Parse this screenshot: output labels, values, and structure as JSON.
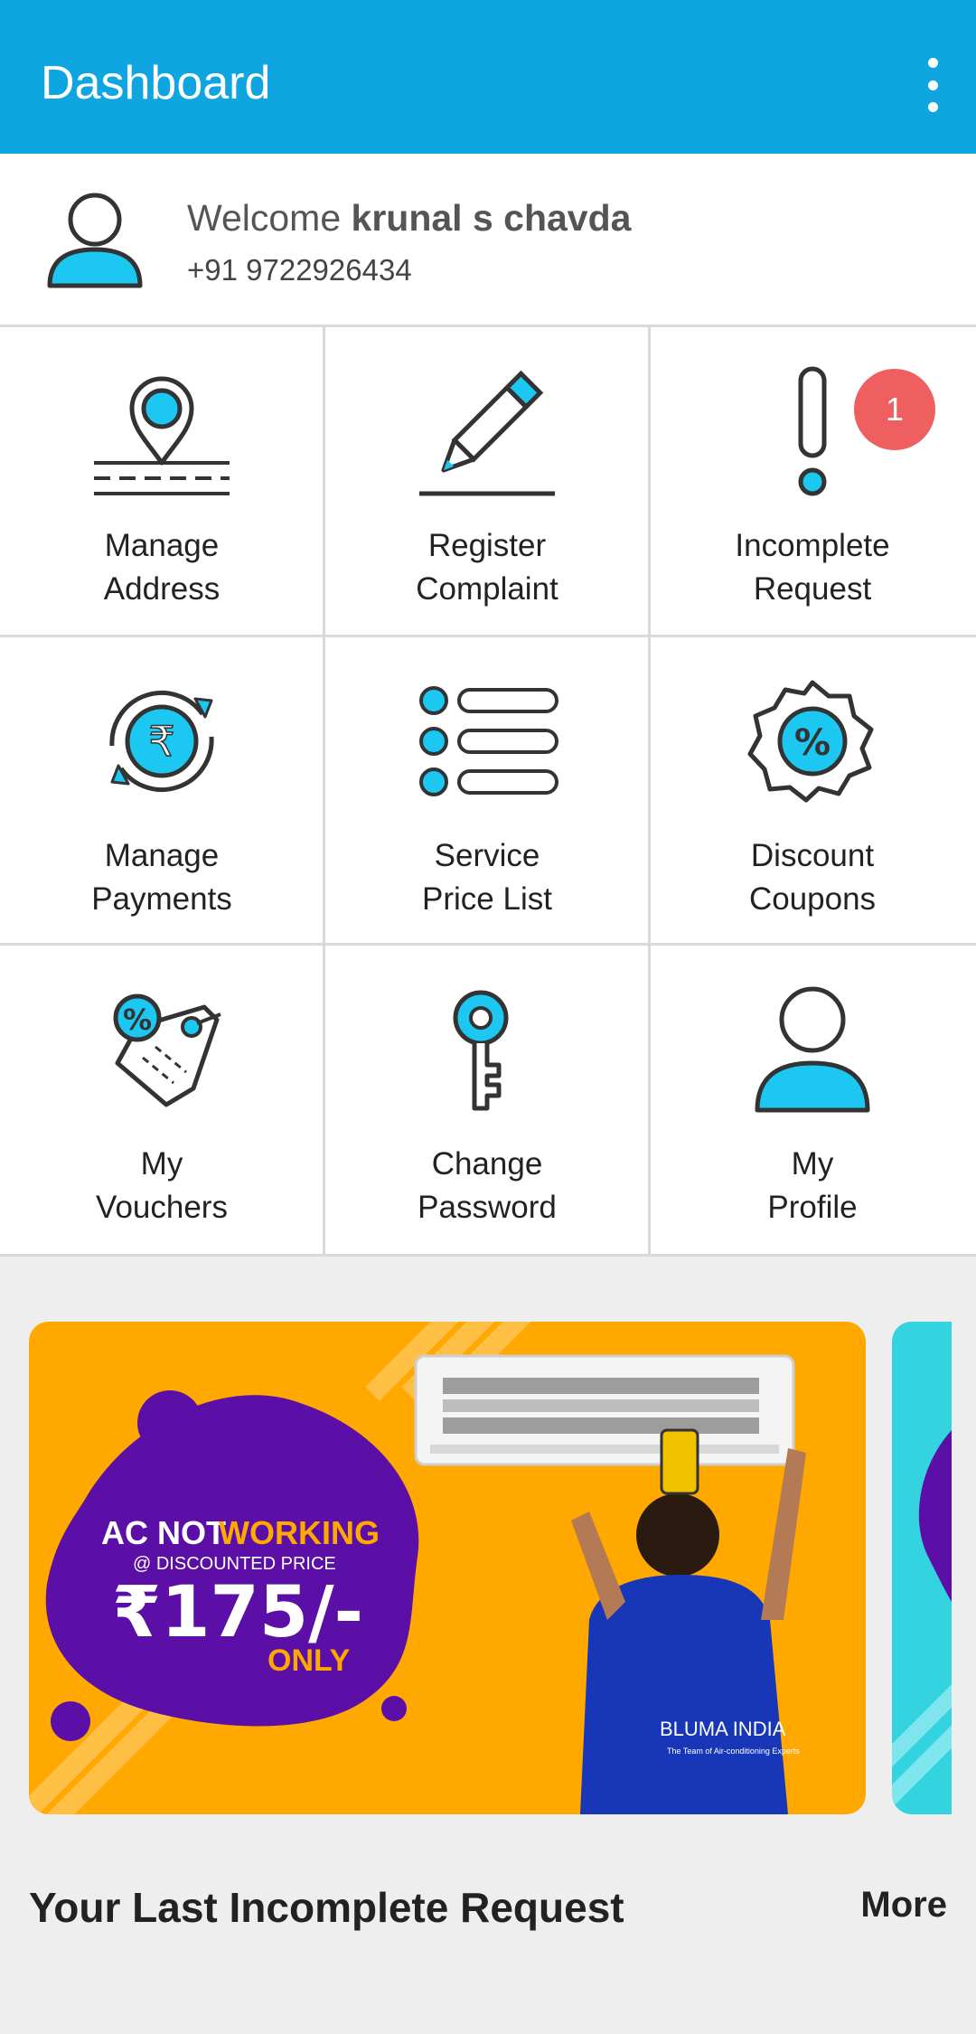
{
  "appbar": {
    "title": "Dashboard"
  },
  "user": {
    "welcome_prefix": "Welcome ",
    "name": "krunal s chavda",
    "phone": "+91 9722926434"
  },
  "tiles": [
    {
      "label": "Manage\nAddress",
      "icon": "location-pin-icon"
    },
    {
      "label": "Register\nComplaint",
      "icon": "pencil-icon"
    },
    {
      "label": "Incomplete\nRequest",
      "icon": "exclamation-icon",
      "badge": "1"
    },
    {
      "label": "Manage\nPayments",
      "icon": "rupee-cycle-icon"
    },
    {
      "label": "Service\nPrice List",
      "icon": "list-icon"
    },
    {
      "label": "Discount\nCoupons",
      "icon": "percent-badge-icon"
    },
    {
      "label": "My\nVouchers",
      "icon": "voucher-tag-icon"
    },
    {
      "label": "Change\nPassword",
      "icon": "key-icon"
    },
    {
      "label": "My\nProfile",
      "icon": "profile-icon"
    }
  ],
  "banner": {
    "line1a": "AC NOT",
    "line1b": "WORKING",
    "line2": "@ DISCOUNTED PRICE",
    "price": "₹175/-",
    "only": "ONLY",
    "brand": "BLUMA INDIA",
    "tagline": "The Team of Air-conditioning Experts"
  },
  "section": {
    "title": "Your Last Incomplete Request",
    "more": "More"
  },
  "colors": {
    "primary": "#0ea5e0",
    "accent_cyan": "#1cc7f2",
    "badge": "#ef5f5f",
    "banner_bg": "#ffa800",
    "banner_blob": "#5b0fa6"
  }
}
